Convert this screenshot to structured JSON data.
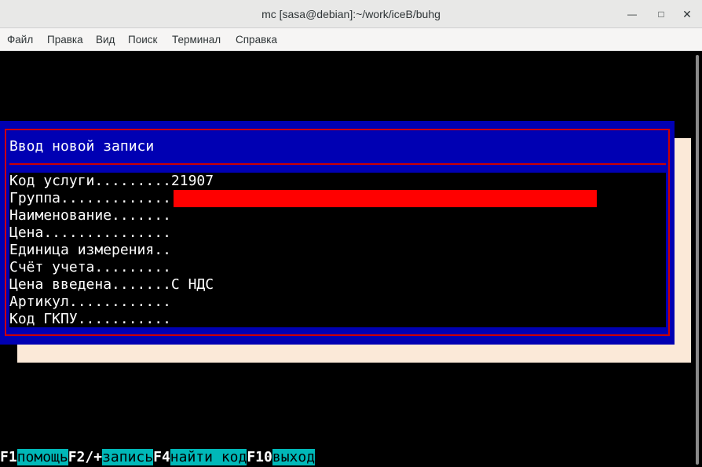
{
  "window": {
    "title": "mc [sasa@debian]:~/work/iceB/buhg"
  },
  "menu": [
    "Файл",
    "Правка",
    "Вид",
    "Поиск",
    "Терминал",
    "Справка"
  ],
  "dialog": {
    "title": "Ввод новой записи",
    "fields": [
      {
        "label": "Код услуги.........",
        "value": "21907"
      },
      {
        "label": "Группа.............",
        "value": ""
      },
      {
        "label": "Наименование.......",
        "value": ""
      },
      {
        "label": "Цена...............",
        "value": ""
      },
      {
        "label": "Единица измерения..",
        "value": ""
      },
      {
        "label": "Счёт учета.........",
        "value": ""
      },
      {
        "label": "Цена введена.......",
        "value": "С НДС"
      },
      {
        "label": "Артикул............",
        "value": ""
      },
      {
        "label": "Код ГКПУ...........",
        "value": ""
      }
    ]
  },
  "fkeys": [
    {
      "key": "F1",
      "label": "помощь"
    },
    {
      "key": "F2/+",
      "label": "запись"
    },
    {
      "key": "F4",
      "label": "найти код"
    },
    {
      "key": "F10",
      "label": "выход"
    }
  ],
  "colors": {
    "dialog_bg": "#0000b3",
    "frame": "#cc0000",
    "highlight": "#ff0000",
    "fkey_label_bg": "#00b8b8",
    "shadow": "#fbe9d8"
  }
}
